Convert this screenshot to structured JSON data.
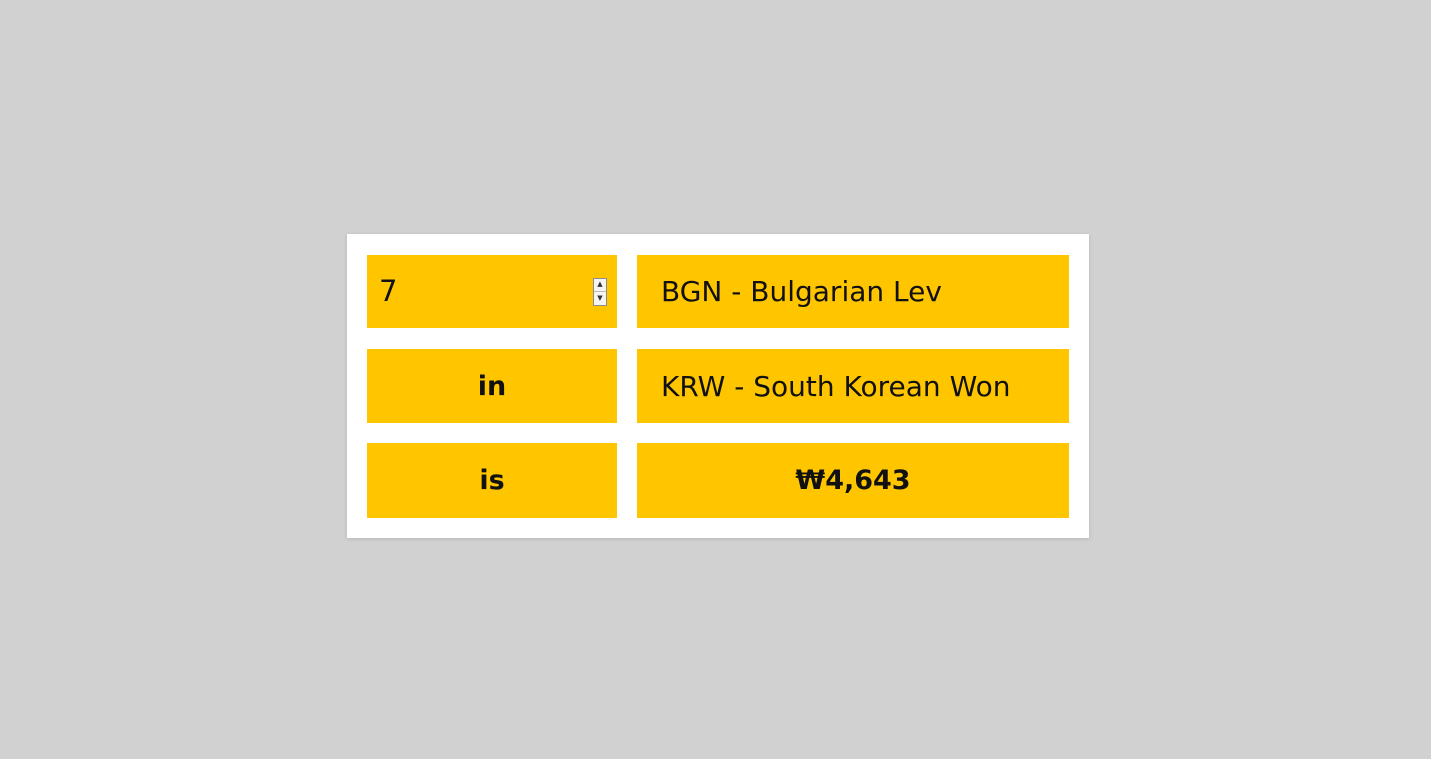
{
  "converter": {
    "amount_value": "7",
    "spinner": {
      "up_icon": "caret-up-icon",
      "down_icon": "caret-down-icon"
    },
    "from_currency": "BGN - Bulgarian Lev",
    "in_label": "in",
    "to_currency": "KRW - South Korean Won",
    "is_label": "is",
    "result": "₩4,643"
  },
  "colors": {
    "background": "#d1d1d1",
    "card": "#ffffff",
    "accent": "#ffc600",
    "text": "#111111"
  }
}
